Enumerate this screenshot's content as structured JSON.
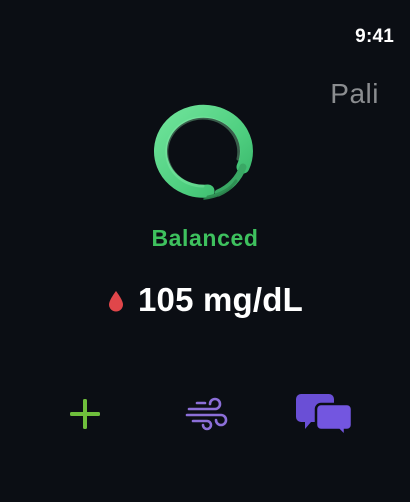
{
  "status_bar": {
    "time": "9:41"
  },
  "header": {
    "app_name": "Pali"
  },
  "status_ring": {
    "icon": "enso-ring-icon",
    "color": "#5ed68a"
  },
  "state": {
    "label": "Balanced",
    "color": "#3ec15e"
  },
  "reading": {
    "icon": "blood-drop-icon",
    "icon_color": "#e0464a",
    "value": "105 mg/dL"
  },
  "actions": [
    {
      "name": "add",
      "icon": "plus-icon",
      "color": "#6fbf3c"
    },
    {
      "name": "breathe",
      "icon": "wind-icon",
      "color": "#8c6fd8"
    },
    {
      "name": "chat",
      "icon": "chat-bubbles-icon",
      "color": "#6a4fd6"
    }
  ]
}
